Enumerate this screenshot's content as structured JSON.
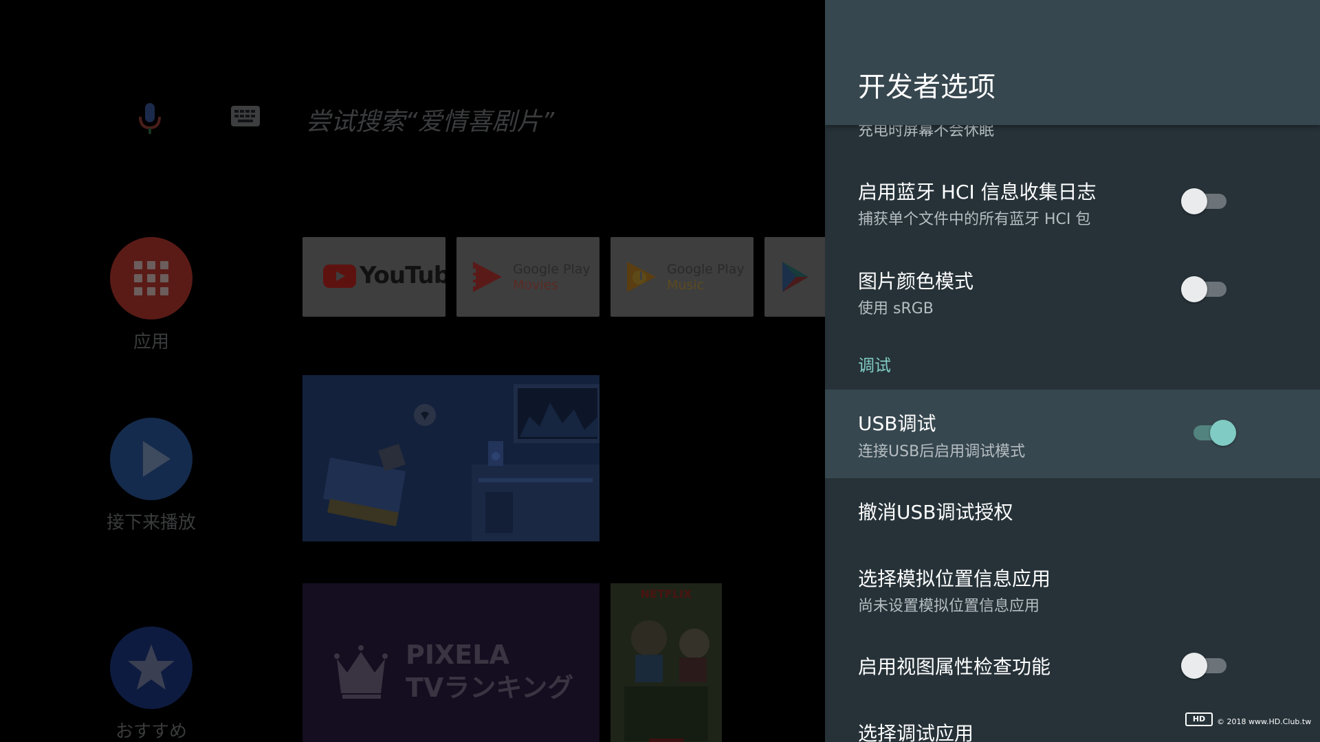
{
  "launcher": {
    "search_hint": "尝试搜索“爱情喜剧片”",
    "rail": [
      {
        "label": "应用",
        "icon": "apps-grid-icon"
      },
      {
        "label": "接下来播放",
        "icon": "play-icon"
      },
      {
        "label": "おすすめ",
        "icon": "star-icon"
      }
    ],
    "tiles": {
      "youtube": "YouTube",
      "play_movies_line1": "Google Play",
      "play_movies_line2": "Movies",
      "play_music_line1": "Google Play",
      "play_music_line2": "Music"
    },
    "pixela_line1": "PIXELA",
    "pixela_line2": "TVランキング",
    "poster_brand": "NETFLIX"
  },
  "panel": {
    "title": "开发者选项",
    "clipped_summary": "充电时屏幕不会休眠",
    "items": [
      {
        "title": "启用蓝牙 HCI 信息收集日志",
        "summary": "捕获单个文件中的所有蓝牙 HCI 包",
        "toggle": false
      },
      {
        "title": "图片颜色模式",
        "summary": "使用 sRGB",
        "toggle": false
      },
      {
        "title": "USB调试",
        "summary": "连接USB后启用调试模式",
        "toggle": true
      },
      {
        "title": "撤消USB调试授权"
      },
      {
        "title": "选择模拟位置信息应用",
        "summary": "尚未设置模拟位置信息应用"
      },
      {
        "title": "启用视图属性检查功能",
        "toggle": false
      },
      {
        "title": "选择调试应用"
      }
    ],
    "category_debug": "调试"
  },
  "watermark": {
    "logo": "HD",
    "text": "© 2018 www.HD.Club.tw"
  },
  "colors": {
    "accent": "#80cbc4",
    "panel_bg": "#263238",
    "header_bg": "#37474f"
  }
}
